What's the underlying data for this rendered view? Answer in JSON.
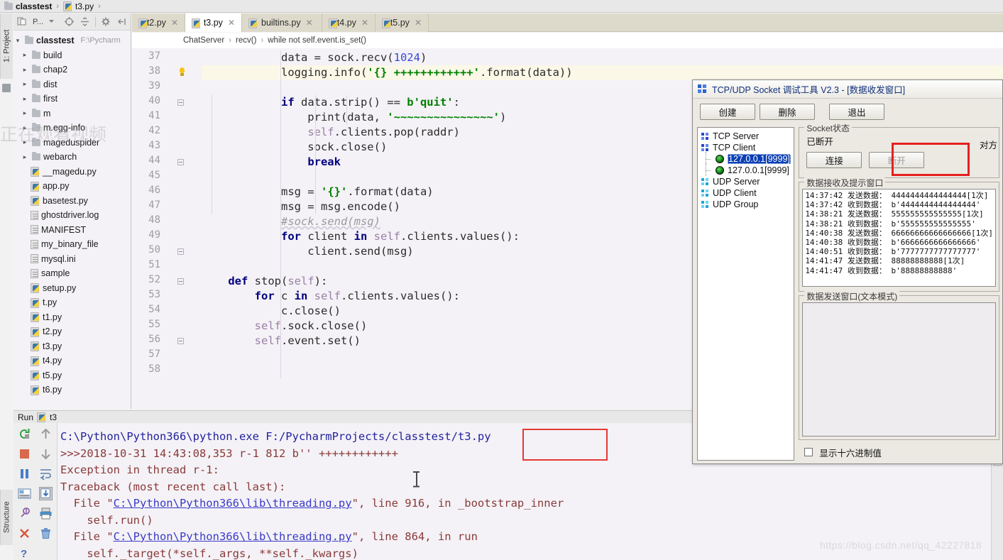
{
  "topbar": {
    "project_name": "classtest",
    "file_name": "t3.py",
    "sep": "›"
  },
  "left_strips": {
    "project": "1: Project",
    "structure": "Structure"
  },
  "project_tool": {
    "toolbar_label": "P...",
    "root": {
      "label": "classtest",
      "path": "F:\\Pycharm"
    },
    "items": [
      {
        "label": "build",
        "type": "folder",
        "expandable": true
      },
      {
        "label": "chap2",
        "type": "folder",
        "expandable": true
      },
      {
        "label": "dist",
        "type": "folder",
        "expandable": true
      },
      {
        "label": "first",
        "type": "folder",
        "expandable": true
      },
      {
        "label": "m",
        "type": "folder",
        "expandable": true
      },
      {
        "label": "m.egg-info",
        "type": "folder",
        "expandable": true
      },
      {
        "label": "mageduspider",
        "type": "folder",
        "expandable": true
      },
      {
        "label": "webarch",
        "type": "folder",
        "expandable": true
      },
      {
        "label": "__magedu.py",
        "type": "py",
        "expandable": false
      },
      {
        "label": "app.py",
        "type": "py",
        "expandable": false
      },
      {
        "label": "basetest.py",
        "type": "py",
        "expandable": false
      },
      {
        "label": "ghostdriver.log",
        "type": "doc",
        "expandable": false
      },
      {
        "label": "MANIFEST",
        "type": "doc",
        "expandable": false
      },
      {
        "label": "my_binary_file",
        "type": "doc",
        "expandable": false
      },
      {
        "label": "mysql.ini",
        "type": "doc",
        "expandable": false
      },
      {
        "label": "sample",
        "type": "doc",
        "expandable": false
      },
      {
        "label": "setup.py",
        "type": "py",
        "expandable": false
      },
      {
        "label": "t.py",
        "type": "py",
        "expandable": false
      },
      {
        "label": "t1.py",
        "type": "py",
        "expandable": false
      },
      {
        "label": "t2.py",
        "type": "py",
        "expandable": false
      },
      {
        "label": "t3.py",
        "type": "py",
        "expandable": false
      },
      {
        "label": "t4.py",
        "type": "py",
        "expandable": false
      },
      {
        "label": "t5.py",
        "type": "py",
        "expandable": false
      },
      {
        "label": "t6.py",
        "type": "py",
        "expandable": false
      }
    ]
  },
  "editor_tabs": [
    {
      "label": "t2.py",
      "active": false
    },
    {
      "label": "t3.py",
      "active": true
    },
    {
      "label": "builtins.py",
      "active": false
    },
    {
      "label": "t4.py",
      "active": false
    },
    {
      "label": "t5.py",
      "active": false
    }
  ],
  "code_breadcrumb": [
    "ChatServer",
    "recv()",
    "while not self.event.is_set()"
  ],
  "editor": {
    "first_line": 37,
    "highlighted_line": 38,
    "line_numbers": [
      37,
      38,
      39,
      40,
      41,
      42,
      43,
      44,
      45,
      46,
      47,
      48,
      49,
      50,
      51,
      52,
      53,
      54,
      55,
      56,
      57,
      58
    ],
    "lines": [
      "            data = sock.recv(1024)",
      "            logging.info('{} ++++++++++++'.format(data))",
      "",
      "            if data.strip() == b'quit':",
      "                print(data, '~~~~~~~~~~~~~~~')",
      "                self.clients.pop(raddr)",
      "                sock.close()",
      "                break",
      "",
      "            msg = '{}'.format(data)",
      "            msg = msg.encode()",
      "            #sock.send(msg)",
      "            for client in self.clients.values():",
      "                client.send(msg)",
      "",
      "    def stop(self):",
      "        for c in self.clients.values():",
      "            c.close()",
      "        self.sock.close()",
      "        self.event.set()",
      "",
      ""
    ]
  },
  "run_tool": {
    "title": "Run",
    "config_name": "t3",
    "console_lines": [
      "C:\\Python\\Python366\\python.exe F:/PycharmProjects/classtest/t3.py",
      ">>>2018-10-31 14:43:08,353 r-1 812 b'' ++++++++++++",
      "Exception in thread r-1:",
      "Traceback (most recent call last):",
      "  File \"C:\\Python\\Python366\\lib\\threading.py\", line 916, in _bootstrap_inner",
      "    self.run()",
      "  File \"C:\\Python\\Python366\\lib\\threading.py\", line 864, in run",
      "    self._target(*self._args, **self._kwargs)"
    ]
  },
  "socket_dialog": {
    "title": "TCP/UDP Socket 调试工具 V2.3 - [数据收发窗口]",
    "toolbar": {
      "create": "创建",
      "delete": "删除",
      "exit": "退出"
    },
    "tree": [
      {
        "label": "TCP Server",
        "type": "group",
        "selected": false
      },
      {
        "label": "TCP Client",
        "type": "group",
        "selected": false
      },
      {
        "label": "127.0.0.1[9999]",
        "type": "conn",
        "selected": true
      },
      {
        "label": "127.0.0.1[9999]",
        "type": "conn",
        "selected": false
      },
      {
        "label": "UDP Server",
        "type": "group-cyan",
        "selected": false
      },
      {
        "label": "UDP Client",
        "type": "group-cyan",
        "selected": false
      },
      {
        "label": "UDP Group",
        "type": "group-cyan",
        "selected": false
      }
    ],
    "socket_state": {
      "legend": "Socket状态",
      "status": "已断开",
      "peer_label": "对方",
      "connect_button": "连接",
      "disconnect_button": "断开"
    },
    "recv_panel": {
      "legend": "数据接收及提示窗口",
      "lines": [
        "14:37:42 发送数据： 4444444444444444[1次]",
        "14:37:42 收到数据： b'4444444444444444'",
        "14:38:21 发送数据： 555555555555555[1次]",
        "14:38:21 收到数据： b'555555555555555'",
        "14:40:38 发送数据： 66666666666666666[1次]",
        "14:40:38 收到数据： b'6666666666666666'",
        "14:40:51 收到数据： b'7777777777777777'",
        "14:41:47 发送数据： 88888888888[1次]",
        "14:41:47 收到数据： b'88888888888'"
      ]
    },
    "send_panel": {
      "legend": "数据发送窗口(文本模式)",
      "value": ""
    },
    "hex_checkbox": {
      "label": "显示十六进制值",
      "checked": false
    }
  },
  "watermarks": {
    "overlay_text": "正在观看视频",
    "blog_url": "https://blog.csdn.net/qq_42227818"
  },
  "colors": {
    "accent_red": "#e62020",
    "tab_active_bg": "#ffffff",
    "tab_inactive_bg": "#dedacb",
    "editor_bg": "#f4f2f6",
    "selection_blue": "#0a3fb5"
  }
}
